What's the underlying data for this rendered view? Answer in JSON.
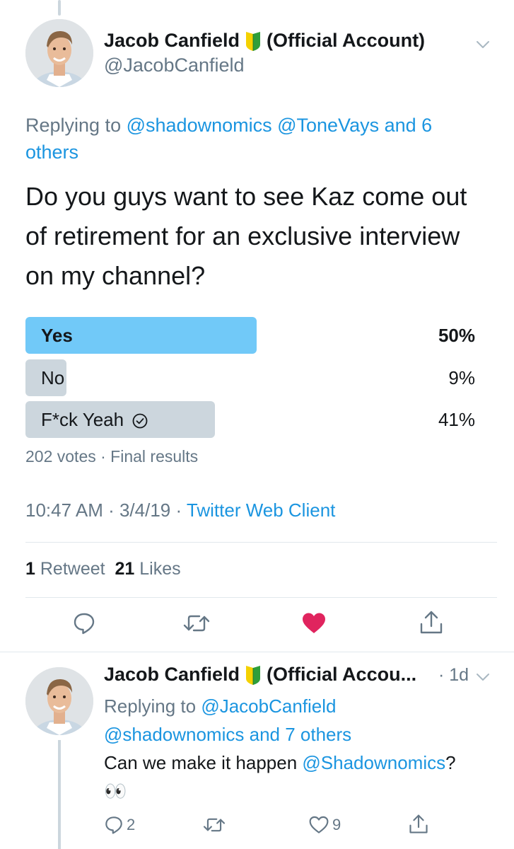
{
  "main_tweet": {
    "display_name": "Jacob Canfield",
    "badge": "japanese-beginner-badge-icon",
    "name_suffix": "(Official Account)",
    "handle": "@JacobCanfield",
    "replying_prefix": "Replying to",
    "replying_users": "@shadownomics @ToneVays",
    "replying_and": "and 6",
    "replying_others": "others",
    "text": "Do you guys want to see Kaz come out of retirement for an exclusive interview on my channel?",
    "poll": [
      {
        "label": "Yes",
        "percent": "50%",
        "fraction": 0.5,
        "leading": true
      },
      {
        "label": "No",
        "percent": "9%",
        "fraction": 0.09,
        "leading": false
      },
      {
        "label": "F*ck Yeah",
        "percent": "41%",
        "fraction": 0.41,
        "leading": false,
        "voted": true
      }
    ],
    "poll_meta": "202 votes · Final results",
    "time": "10:47 AM · 3/4/19 ·",
    "client": "Twitter Web Client",
    "retweet_count": "1",
    "retweet_label": "Retweet",
    "like_count": "21",
    "like_label": "Likes"
  },
  "reply_tweet": {
    "display_name": "Jacob Canfield",
    "name_suffix": "(Official Accou...",
    "age": "· 1d",
    "replying_prefix": "Replying to",
    "replying_user1": "@JacobCanfield",
    "replying_user2": "@shadownomics",
    "replying_rest": "and 7 others",
    "text_prefix": "Can we make it happen",
    "text_mention": "@Shadownomics",
    "text_suffix": "?",
    "emoji": "👀",
    "reply_count": "2",
    "retweet_count": "",
    "like_count": "9"
  },
  "colors": {
    "accent": "#1b95e0",
    "poll_leading": "#71c9f8",
    "poll_other": "#ccd6dd",
    "like_red": "#e0245e",
    "secondary_text": "#657786"
  }
}
